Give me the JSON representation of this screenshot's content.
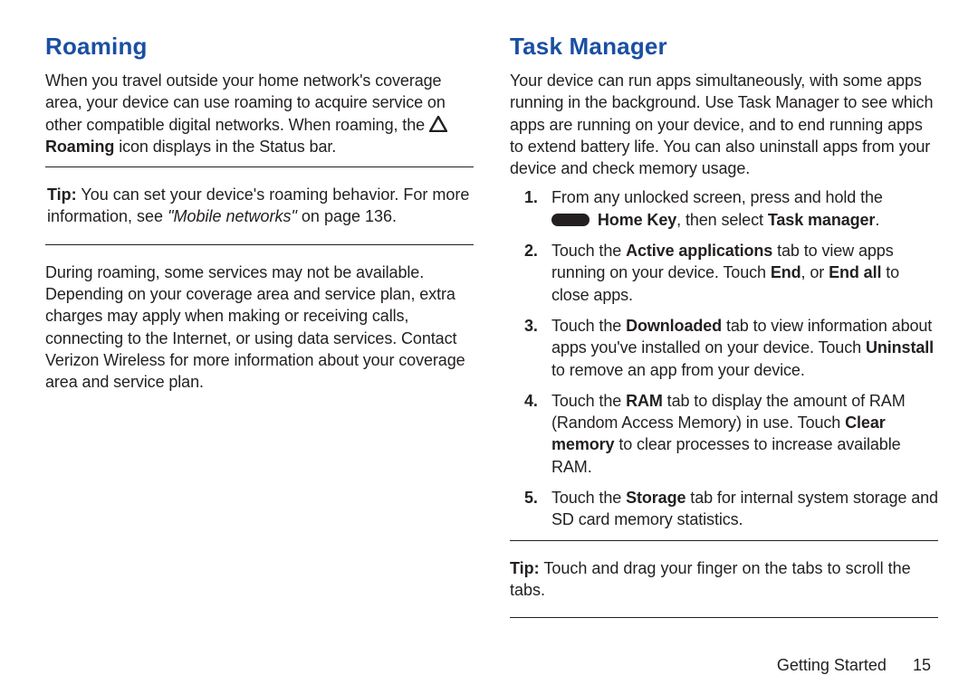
{
  "left": {
    "heading": "Roaming",
    "para1_a": "When you travel outside your home network's coverage area, your device can use roaming to acquire service on other compatible digital networks. When roaming, the ",
    "para1_b": "Roaming",
    "para1_c": " icon displays in the Status bar.",
    "tip_label": "Tip:",
    "tip_a": " You can set your device's roaming behavior. For more information, see ",
    "tip_b": "\"Mobile networks\"",
    "tip_c": " on page 136.",
    "para2": "During roaming, some services may not be available. Depending on your coverage area and service plan, extra charges may apply when making or receiving calls, connecting to the Internet, or using data services. Contact Verizon Wireless for more information about your coverage area and service plan."
  },
  "right": {
    "heading": "Task Manager",
    "intro": "Your device can run apps simultaneously, with some apps running in the background. Use Task Manager to see which apps are running on your device, and to end running apps to extend battery life. You can also uninstall apps from your device and check memory usage.",
    "steps": {
      "s1_a": "From any unlocked screen, press and hold the ",
      "s1_home": "Home Key",
      "s1_b": ", then select ",
      "s1_tm": "Task manager",
      "s1_c": ".",
      "s2_a": "Touch the ",
      "s2_active": "Active applications",
      "s2_b": " tab to view apps running on your device. Touch ",
      "s2_end": "End",
      "s2_c": ", or ",
      "s2_endall": "End all",
      "s2_d": " to close apps.",
      "s3_a": "Touch the ",
      "s3_dl": "Downloaded",
      "s3_b": " tab to view information about apps you've installed on your device. Touch ",
      "s3_un": "Uninstall",
      "s3_c": " to remove an app from your device.",
      "s4_a": "Touch the ",
      "s4_ram": "RAM",
      "s4_b": " tab to display the amount of RAM (Random Access Memory) in use. Touch ",
      "s4_clear": "Clear memory",
      "s4_c": " to clear processes to increase available RAM.",
      "s5_a": "Touch the ",
      "s5_storage": "Storage",
      "s5_b": " tab for internal system storage and SD card memory statistics."
    },
    "tip_label": "Tip:",
    "tip_text": " Touch and drag your finger on the tabs to scroll the tabs."
  },
  "footer": {
    "section": "Getting Started",
    "page": "15"
  }
}
